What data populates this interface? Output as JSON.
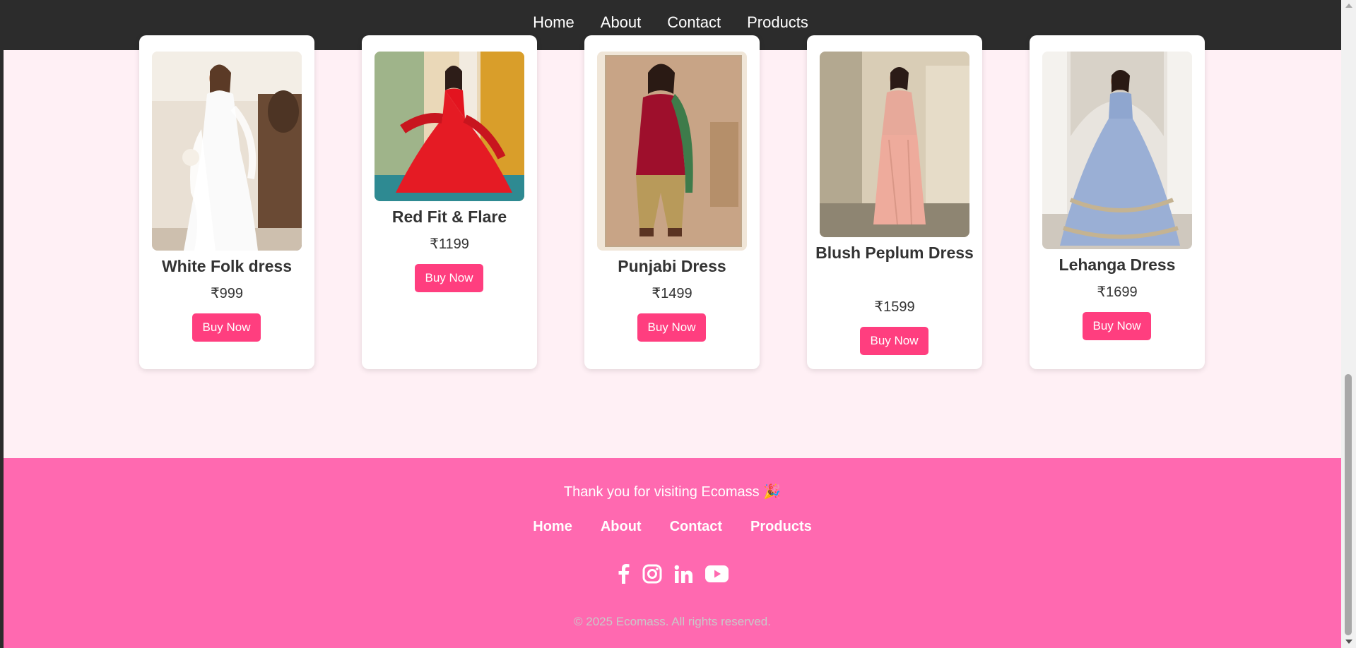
{
  "nav": {
    "links": [
      "Home",
      "About",
      "Contact",
      "Products"
    ]
  },
  "products": [
    {
      "name": "White Folk dress",
      "price": "₹999",
      "button": "Buy Now"
    },
    {
      "name": "Red Fit & Flare",
      "price": "₹1199",
      "button": "Buy Now"
    },
    {
      "name": "Punjabi Dress",
      "price": "₹1499",
      "button": "Buy Now"
    },
    {
      "name": "Blush Peplum Dress",
      "price": "₹1599",
      "button": "Buy Now"
    },
    {
      "name": "Lehanga Dress",
      "price": "₹1699",
      "button": "Buy Now"
    }
  ],
  "footer": {
    "thanks": "Thank you for visiting Ecomass 🎉",
    "links": [
      "Home",
      "About",
      "Contact",
      "Products"
    ],
    "social": [
      "facebook-icon",
      "instagram-icon",
      "linkedin-icon",
      "youtube-icon"
    ],
    "copyright": "© 2025 Ecomass. All rights reserved."
  },
  "colors": {
    "navbar": "#2c2c2c",
    "page_background": "#fff0f5",
    "accent": "#ff3e7f",
    "footer": "#ff69b0"
  }
}
